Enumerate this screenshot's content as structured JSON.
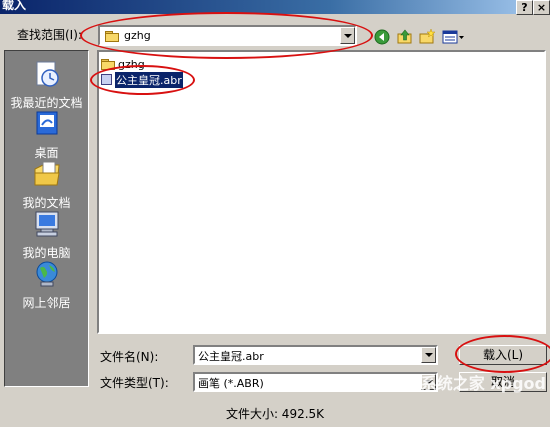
{
  "window": {
    "title": "载入",
    "help_button": "?",
    "close_button": "×"
  },
  "toolbar": {
    "look_in_label": "查找范围(I):",
    "look_in_value": "gzhg",
    "icons": [
      "back-icon",
      "up-folder-icon",
      "new-folder-icon",
      "view-menu-icon"
    ]
  },
  "places": [
    {
      "label": "我最近的文档",
      "icon": "recent-documents-icon"
    },
    {
      "label": "桌面",
      "icon": "desktop-icon"
    },
    {
      "label": "我的文档",
      "icon": "my-documents-icon"
    },
    {
      "label": "我的电脑",
      "icon": "my-computer-icon"
    },
    {
      "label": "网上邻居",
      "icon": "network-places-icon"
    }
  ],
  "files": [
    {
      "name": "gzhg",
      "type": "folder"
    },
    {
      "name": "公主皇冠.abr",
      "type": "abr",
      "selected": true
    }
  ],
  "filename": {
    "label": "文件名(N):",
    "value": "公主皇冠.abr"
  },
  "filetype": {
    "label": "文件类型(T):",
    "value": "画笔 (*.ABR)"
  },
  "buttons": {
    "load": "载入(L)",
    "cancel": "取消"
  },
  "status": {
    "text": "文件大小: 492.5K"
  },
  "watermark": {
    "text": "系统之家 xpgod"
  },
  "colors": {
    "highlight": "#0a246a",
    "annotation": "#d81010",
    "dialog": "#d4d0c8"
  }
}
